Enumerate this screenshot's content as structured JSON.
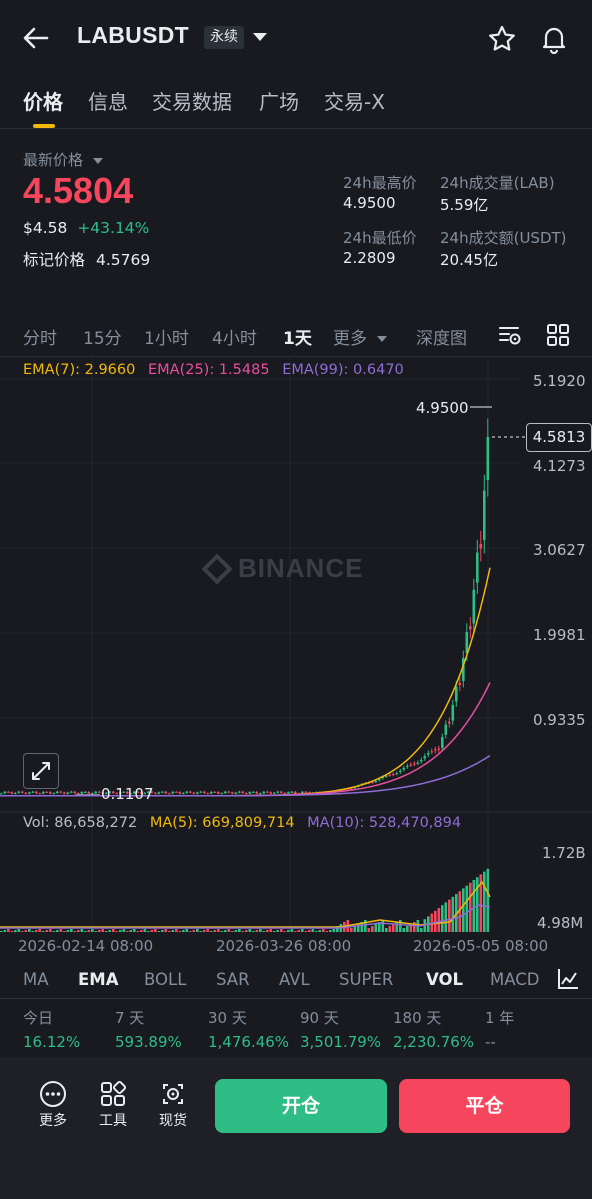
{
  "header": {
    "symbol": "LABUSDT",
    "contract_type": "永续",
    "icons": [
      "back-arrow-icon",
      "chevron-down-icon",
      "star-icon",
      "bell-icon"
    ]
  },
  "tabs": [
    "价格",
    "信息",
    "交易数据",
    "广场",
    "交易-X"
  ],
  "price_panel": {
    "latest_label": "最新价格",
    "price": "4.5804",
    "usd_price": "$4.58",
    "change": "+43.14%",
    "mark_label": "标记价格",
    "mark_price": "4.5769",
    "stats": {
      "high_label": "24h最高价",
      "high": "4.9500",
      "low_label": "24h最低价",
      "low": "2.2809",
      "vol_base_label": "24h成交量(LAB)",
      "vol_base": "5.59亿",
      "vol_quote_label": "24h成交额(USDT)",
      "vol_quote": "20.45亿"
    }
  },
  "timeframes": [
    "分时",
    "15分",
    "1小时",
    "4小时",
    "1天",
    "更多",
    "深度图"
  ],
  "active_timeframe": "1天",
  "chart": {
    "ema7": "EMA(7): 2.9660",
    "ema25": "EMA(25): 1.5485",
    "ema99": "EMA(99): 0.6470",
    "y_ticks": [
      "5.1920",
      "4.1273",
      "3.0627",
      "1.9981",
      "0.9335"
    ],
    "high_marker": "4.9500",
    "low_marker": "0.1107",
    "last_price_tag": "4.5813",
    "watermark": "BINANCE",
    "vol": "Vol: 86,658,272",
    "ma5": "MA(5): 669,809,714",
    "ma10": "MA(10): 528,470,894",
    "vol_ticks": [
      "1.72B",
      "4.98M"
    ],
    "dates": [
      "2026-02-14 08:00",
      "2026-03-26 08:00",
      "2026-05-05 08:00"
    ],
    "colors": {
      "up": "#2ebd85",
      "down": "#f6465d",
      "ema7": "#f0b90b",
      "ema25": "#e84ea0",
      "ema99": "#8f6cd6"
    }
  },
  "indicators": [
    "MA",
    "EMA",
    "BOLL",
    "SAR",
    "AVL",
    "SUPER",
    "VOL",
    "MACD"
  ],
  "performance": {
    "labels": [
      "今日",
      "7 天",
      "30 天",
      "90 天",
      "180 天",
      "1 年"
    ],
    "values": [
      "16.12%",
      "593.89%",
      "1,476.46%",
      "3,501.79%",
      "2,230.76%",
      "--"
    ]
  },
  "bottom": {
    "more": "更多",
    "tools": "工具",
    "spot": "现货",
    "open": "开仓",
    "close": "平仓"
  }
}
